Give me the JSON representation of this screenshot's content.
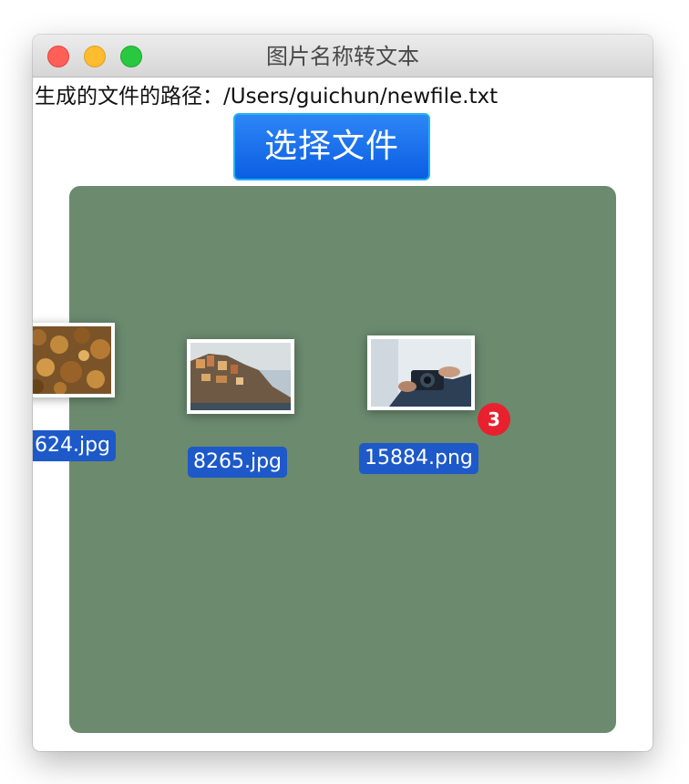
{
  "window": {
    "title": "图片名称转文本"
  },
  "output": {
    "path_label": "生成的文件的路径：/Users/guichun/newfile.txt"
  },
  "toolbar": {
    "choose_file_label": "选择文件"
  },
  "drag_items": [
    {
      "label": "624.jpg",
      "thumb_icon": "autumn-leaves-photo"
    },
    {
      "label": "8265.jpg",
      "thumb_icon": "coastal-town-photo"
    },
    {
      "label": "15884.png",
      "thumb_icon": "hands-with-camera-photo"
    }
  ],
  "drag_badge": {
    "count": "3"
  },
  "colors": {
    "drop_area": "#6b8a6e",
    "label_bg": "#1d59c9",
    "button": "#0b5ee3",
    "badge": "#e8212f"
  }
}
